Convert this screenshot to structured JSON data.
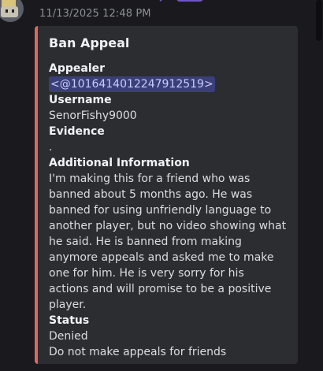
{
  "message": {
    "timestamp": "11/13/2025 12:48 PM",
    "embed": {
      "accent_color": "#e0675f",
      "title": "Ban Appeal",
      "fields": [
        {
          "name": "Appealer",
          "value": "<@1016414012247912519>"
        },
        {
          "name": "Username",
          "value": "SenorFishy9000"
        },
        {
          "name": "Evidence",
          "value": "."
        },
        {
          "name": "Additional Information",
          "value": "I'm making this for a friend who was banned about 5 months ago. He was banned for using unfriendly language to another player, but no video showing what he said. He is banned from making anymore appeals and asked me to make one for him. He is very sorry for his actions and will promise to be a positive player."
        },
        {
          "name": "Status",
          "value": "Denied\nDo not make appeals for friends"
        }
      ]
    }
  },
  "icons": {
    "avatar": "avatar-icon",
    "decor": "reaction-icon"
  }
}
